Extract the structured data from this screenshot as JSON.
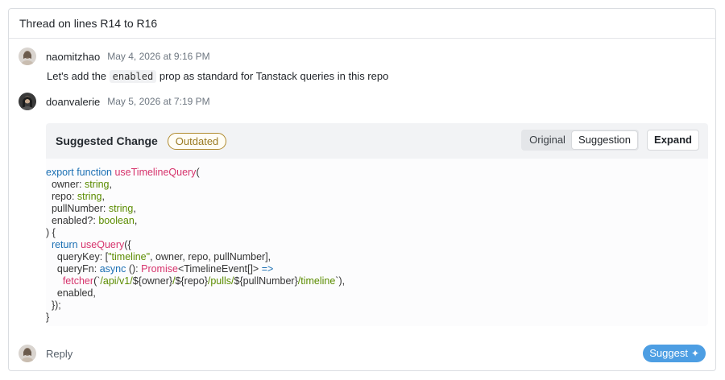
{
  "thread": {
    "title": "Thread on lines R14 to R16"
  },
  "comments": [
    {
      "author": "naomitzhao",
      "time": "May 4, 2026 at 9:16 PM",
      "text_before": "Let's add the ",
      "code": "enabled",
      "text_after": " prop as standard for Tanstack queries in this repo"
    },
    {
      "author": "doanvalerie",
      "time": "May 5, 2026 at 7:19 PM"
    }
  ],
  "suggestion": {
    "title": "Suggested Change",
    "badge": "Outdated",
    "tab_original": "Original",
    "tab_suggestion": "Suggestion",
    "expand_label": "Expand",
    "code_lines": [
      "export function useTimelineQuery(",
      "  owner: string,",
      "  repo: string,",
      "  pullNumber: string,",
      "  enabled?: boolean,",
      ") {",
      "  return useQuery({",
      "    queryKey: [\"timeline\", owner, repo, pullNumber],",
      "    queryFn: async (): Promise<TimelineEvent[]> =>",
      "      fetcher(`/api/v1/${owner}/${repo}/pulls/${pullNumber}/timeline`),",
      "    enabled,",
      "  });",
      "}"
    ]
  },
  "footer": {
    "reply_label": "Reply",
    "suggest_label": "Suggest",
    "suggest_icon": "sparkle-icon"
  },
  "colors": {
    "accent": "#4d9ee3",
    "badge": "#b08a2e",
    "keyword": "#1a6fb3",
    "function": "#d6336c",
    "type": "#5b8c00"
  }
}
